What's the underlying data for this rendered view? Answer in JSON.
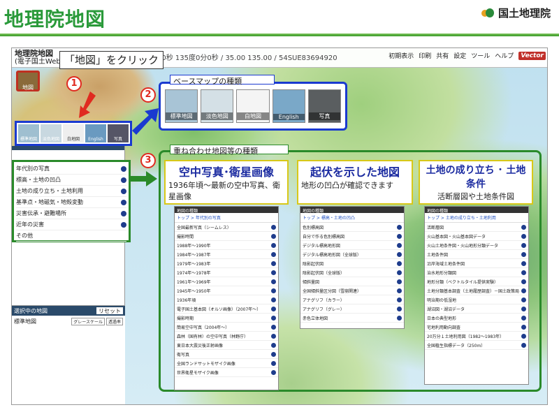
{
  "page": {
    "title": "地理院地図",
    "brand": "国土地理院"
  },
  "app": {
    "logo_line1": "地理院地図",
    "logo_line2": "(電子国土Web)",
    "coords": "度0分0秒 135度0分0秒 / 35.00 135.00 / 54SUE83694920",
    "tools": [
      "初期表示",
      "印刷",
      "共有",
      "設定",
      "ツール",
      "ヘルプ"
    ],
    "vector_badge": "Vector",
    "vector_top": "地理院地図"
  },
  "map_button": {
    "label": "地図"
  },
  "annotations": {
    "callout1": "「地図」をクリック",
    "callout2": "ベースマップの種類",
    "callout3": "重ね合わせ地図等の種類",
    "n1": "1",
    "n2": "2",
    "n3": "3"
  },
  "basemaps": [
    "標準地図",
    "淡色地図",
    "白地図",
    "English",
    "写真"
  ],
  "categories": [
    "年代別の写真",
    "標高・土地の凹凸",
    "土地の成り立ち・土地利用",
    "基準点・地磁気・地殻変動",
    "災害伝承・避難場所",
    "近年の災害",
    "その他"
  ],
  "selected": {
    "header": "選択中の地図",
    "reset": "リセット",
    "item": "標準地図",
    "btn1": "グレースケール",
    "btn2": "透過率"
  },
  "columns": [
    {
      "title": "空中写真･衛星画像",
      "desc": "1936年頃～最新の空中写真、衛星画像",
      "panel_title": "地図の種類",
      "breadcrumb": "トップ > 年代別の写真",
      "rows": [
        "全国最新写真（シームレス）",
        "撮影時間",
        "1988年〜1990年",
        "1984年〜1987年",
        "1979年〜1983年",
        "1974年〜1978年",
        "1961年〜1969年",
        "1945年〜1950年",
        "1936年頃",
        "電子国土基本図（オルソ画像）（2007年〜）",
        "撮影時期",
        "簡易空中写真（2004年〜）",
        "森林（国有林）の空中写真（林野庁）",
        "東日本大震災後正射画像",
        "衛写真",
        "全国ランドサットモザイク画像",
        "世界衛星モザイク画像"
      ]
    },
    {
      "title": "起伏を示した地図",
      "desc": "地形の凹凸が確認できます",
      "panel_title": "地図の種類",
      "breadcrumb": "トップ > 標高・土地の凹凸",
      "rows": [
        "色別標高図",
        "自分で作る色別標高図",
        "デジタル標高地形図",
        "デジタル標高地形図（全球版）",
        "陰影起伏図",
        "陰影起伏図（全球版）",
        "傾斜量図",
        "全国傾斜量区分図（雪崩関連）",
        "アナグリフ（カラー）",
        "アナグリフ（グレー）",
        "赤色立体地図"
      ]
    },
    {
      "title": "土地の成り立ち ･ 土地条件",
      "desc": "活断層図や土地条件図",
      "panel_title": "地図の種類",
      "breadcrumb": "トップ > 土地の成り立ち・土地利用",
      "rows": [
        "活断層図",
        "火山基本図・火山基本図データ",
        "火山土地条件図・火山地形分類データ",
        "土地条件図",
        "沿岸海域土地条件図",
        "治水地形分類図",
        "地形分類（ベクトルタイル提供実験）",
        "土地分類基本調査（土地履歴調査）－国土政策局",
        "明治期の低湿地",
        "湖沼図・湖沼データ",
        "日本の典型地形",
        "宅地利用動向調査",
        "20万分１土地利用図（1982〜1983年）",
        "全国植生指標データ（250m）"
      ]
    }
  ]
}
